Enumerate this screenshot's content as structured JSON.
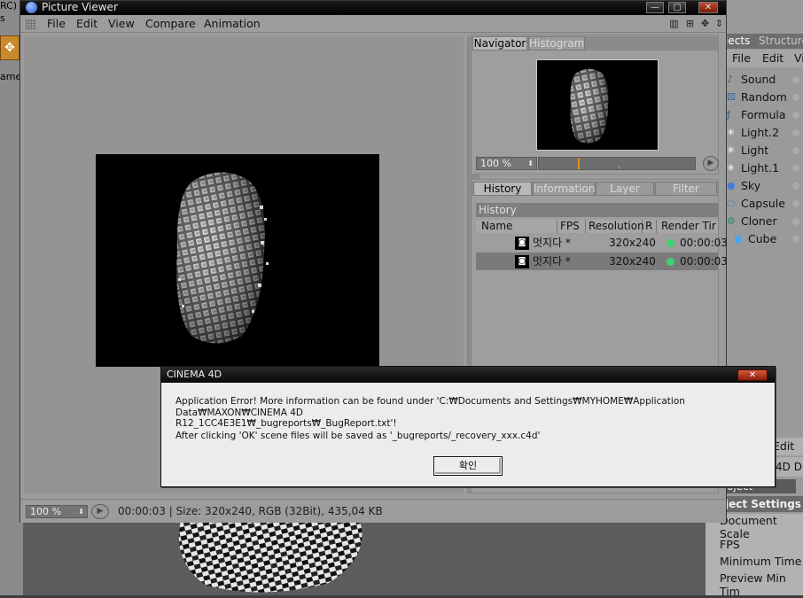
{
  "background": {
    "left_labels": [
      "RC)",
      "s",
      "ame"
    ],
    "right_panel": {
      "tabs": [
        "jects",
        "Structure"
      ],
      "menu": [
        "File",
        "Edit",
        "Vi"
      ],
      "objects": [
        {
          "icon": "sound-icon",
          "label": "Sound"
        },
        {
          "icon": "random-icon",
          "label": "Random"
        },
        {
          "icon": "formula-icon",
          "label": "Formula"
        },
        {
          "icon": "light-icon",
          "label": "Light.2"
        },
        {
          "icon": "light-icon",
          "label": "Light"
        },
        {
          "icon": "light-icon",
          "label": "Light.1"
        },
        {
          "icon": "sky-icon",
          "label": "Sky"
        },
        {
          "icon": "capsule-icon",
          "label": "Capsule"
        },
        {
          "icon": "cloner-icon",
          "label": "Cloner"
        },
        {
          "icon": "cube-icon",
          "label": "Cube"
        }
      ],
      "lower_menu": [
        "Edit"
      ],
      "lower_tabs": [
        "4D D",
        "oject Settings"
      ],
      "settings_header": "ject Settings",
      "settings_rows": [
        "Document Scale",
        "FPS",
        "Minimum Time",
        "Preview Min Tim"
      ]
    }
  },
  "picture_viewer": {
    "title": "Picture Viewer",
    "window_buttons": [
      "—",
      "▢",
      "✕"
    ],
    "menu": [
      "File",
      "Edit",
      "View",
      "Compare",
      "Animation"
    ],
    "navigator": {
      "tabs": [
        "Navigator",
        "Histogram"
      ],
      "active_tab": "Navigator",
      "zoom": "100 %"
    },
    "history": {
      "tabs": [
        "History",
        "Information",
        "Layer",
        "Filter"
      ],
      "active_tab": "History",
      "section_title": "History",
      "columns": [
        "Name",
        "FPS",
        "Resolution",
        "R",
        "Render Tir"
      ],
      "rows": [
        {
          "name": "멋지다 *",
          "fps": "",
          "resolution": "320x240",
          "status_color": "#3bd36b",
          "render_time": "00:00:03"
        },
        {
          "name": "멋지다 *",
          "fps": "",
          "resolution": "320x240",
          "status_color": "#3bd36b",
          "render_time": "00:00:03"
        }
      ]
    },
    "status": {
      "zoom": "100 %",
      "text": "00:00:03 | Size: 320x240, RGB (32Bit), 435,04 KB"
    }
  },
  "dialog": {
    "title": "CINEMA 4D",
    "close": "✕",
    "message_line1": "Application Error! More information can be found under 'C:₩Documents and Settings₩MYHOME₩Application Data₩MAXON₩CINEMA 4D",
    "message_line2": "R12_1CC4E3E1₩_bugreports₩_BugReport.txt'!",
    "message_line3": "After clicking 'OK' scene files will be saved as '_bugreports/_recovery_xxx.c4d'",
    "ok_label": "확인"
  }
}
